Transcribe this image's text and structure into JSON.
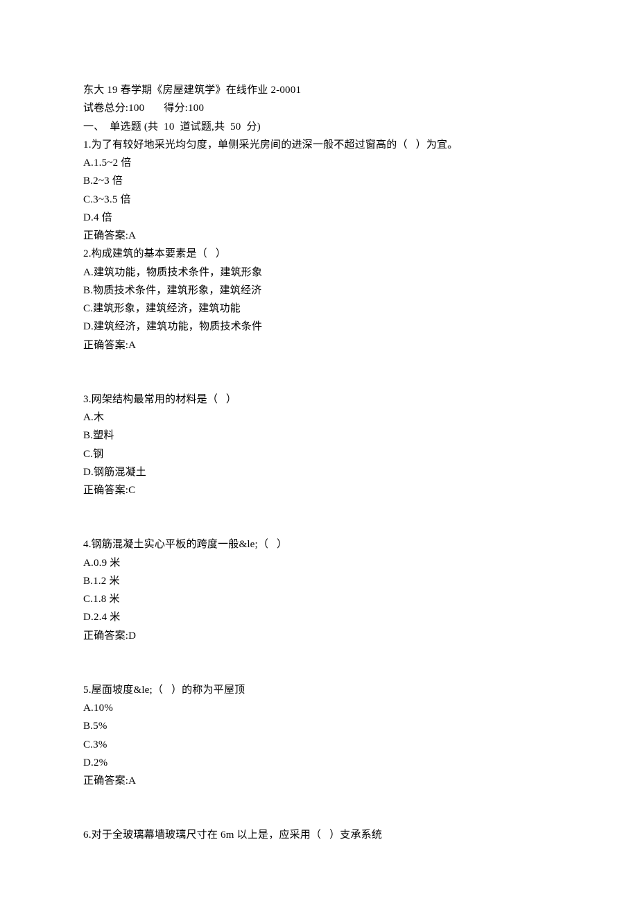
{
  "header": {
    "title_line": "东大 19 春学期《房屋建筑学》在线作业 2-0001",
    "score_line_prefix": "试卷总分:100",
    "score_line_suffix": "得分:100",
    "section_line": "一、  单选题 (共  10  道试题,共  50  分)"
  },
  "questions": [
    {
      "q": "1.为了有较好地采光均匀度，单侧采光房间的进深一般不超过窗高的（   ）为宜。",
      "opts": [
        "A.1.5~2 倍",
        "B.2~3 倍",
        "C.3~3.5 倍",
        "D.4 倍"
      ],
      "ans": "正确答案:A"
    },
    {
      "q": "2.构成建筑的基本要素是（   ）",
      "opts": [
        "A.建筑功能，物质技术条件，建筑形象",
        "B.物质技术条件，建筑形象，建筑经济",
        "C.建筑形象，建筑经济，建筑功能",
        "D.建筑经济，建筑功能，物质技术条件"
      ],
      "ans": "正确答案:A"
    },
    {
      "q": "3.网架结构最常用的材料是（   ）",
      "opts": [
        "A.木",
        "B.塑料",
        "C.钢",
        "D.钢筋混凝土"
      ],
      "ans": "正确答案:C"
    },
    {
      "q": "4.钢筋混凝土实心平板的跨度一般&le;（   ）",
      "opts": [
        "A.0.9 米",
        "B.1.2 米",
        "C.1.8 米",
        "D.2.4 米"
      ],
      "ans": "正确答案:D"
    },
    {
      "q": "5.屋面坡度&le;（   ）的称为平屋顶",
      "opts": [
        "A.10%",
        "B.5%",
        "C.3%",
        "D.2%"
      ],
      "ans": "正确答案:A"
    },
    {
      "q": "6.对于全玻璃幕墙玻璃尺寸在 6m 以上是，应采用（   ）支承系统",
      "opts": [],
      "ans": ""
    }
  ]
}
